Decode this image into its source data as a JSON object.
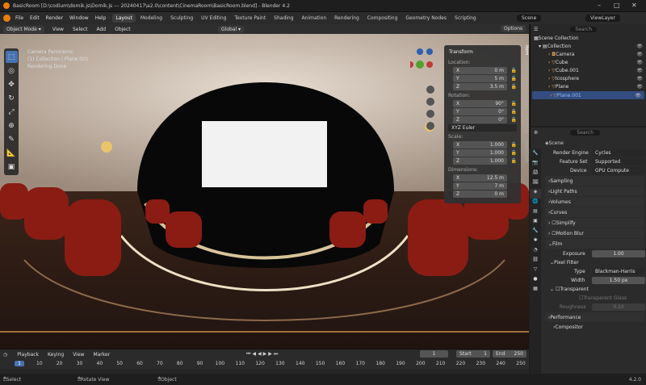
{
  "window": {
    "title": "BasicRoom [D:\\codium\\domik.js\\Domik.js --- 20240417\\a2.0\\content\\CinemaRoom\\BasicRoom.blend] - Blender 4.2"
  },
  "menu": [
    "File",
    "Edit",
    "Render",
    "Window",
    "Help"
  ],
  "workspaces": [
    "Layout",
    "Modeling",
    "Sculpting",
    "UV Editing",
    "Texture Paint",
    "Shading",
    "Animation",
    "Rendering",
    "Compositing",
    "Geometry Nodes",
    "Scripting"
  ],
  "scene_name": "Scene",
  "view_layer": "ViewLayer",
  "header": {
    "mode": "Object Mode",
    "view": "View",
    "select": "Select",
    "add": "Add",
    "object": "Object",
    "orientation": "Global",
    "options": "Options"
  },
  "overlay": {
    "camera": "Camera Panoramic",
    "collection": "(1) Collection | Plane.001",
    "status": "Rendering Done"
  },
  "transform": {
    "title": "Transform",
    "location_label": "Location:",
    "location": {
      "x": "0 m",
      "y": "5 m",
      "z": "3.5 m"
    },
    "rotation_label": "Rotation:",
    "rotation": {
      "x": "90°",
      "y": "0°",
      "z": "0°"
    },
    "rotation_mode": "XYZ Euler",
    "scale_label": "Scale:",
    "scale": {
      "x": "1.000",
      "y": "1.000",
      "z": "1.000"
    },
    "dimensions_label": "Dimensions:",
    "dimensions": {
      "x": "12.5 m",
      "y": "7 m",
      "z": "0 m"
    },
    "axis": {
      "x": "X",
      "y": "Y",
      "z": "Z"
    }
  },
  "ntabs": [
    "Item",
    "Tool",
    "View",
    "Create",
    "3D Print",
    "JewelCraft"
  ],
  "search_placeholder": "Search",
  "outliner": {
    "root": "Scene Collection",
    "items": [
      "Collection",
      "Camera",
      "Cube",
      "Cube.001",
      "Icosphere",
      "Plane",
      "Plane.001"
    ]
  },
  "properties": {
    "scene": "Scene",
    "engine_label": "Render Engine",
    "engine": "Cycles",
    "feature_label": "Feature Set",
    "feature": "Supported",
    "device_label": "Device",
    "device": "GPU Compute",
    "sections": [
      "Sampling",
      "Light Paths",
      "Volumes",
      "Curves",
      "Simplify",
      "Motion Blur",
      "Film"
    ],
    "exposure_label": "Exposure",
    "exposure": "1.00",
    "pixel_filter": "Pixel Filter",
    "type_label": "Type",
    "type": "Blackman-Harris",
    "width_label": "Width",
    "width": "1.50 px",
    "transparent": "Transparent",
    "transparent_glass": "Transparent Glass",
    "roughness_label": "Roughness",
    "roughness": "0.10",
    "performance": "Performance",
    "compositor": "Compositor"
  },
  "timeline": {
    "playback": "Playback",
    "keying": "Keying",
    "view": "View",
    "marker": "Marker",
    "current": "1",
    "start_label": "Start",
    "start": "1",
    "end_label": "End",
    "end": "250",
    "ticks": [
      "1",
      "10",
      "20",
      "30",
      "40",
      "50",
      "60",
      "70",
      "80",
      "90",
      "100",
      "110",
      "120",
      "130",
      "140",
      "150",
      "160",
      "170",
      "180",
      "190",
      "200",
      "210",
      "220",
      "230",
      "240",
      "250"
    ]
  },
  "status": {
    "select": "Select",
    "rotate": "Rotate View",
    "object": "Object",
    "version": "4.2.0"
  },
  "colors": {
    "accent": "#4772b3",
    "selected_row": "#334d80",
    "blender_orange": "#e87d0d"
  }
}
